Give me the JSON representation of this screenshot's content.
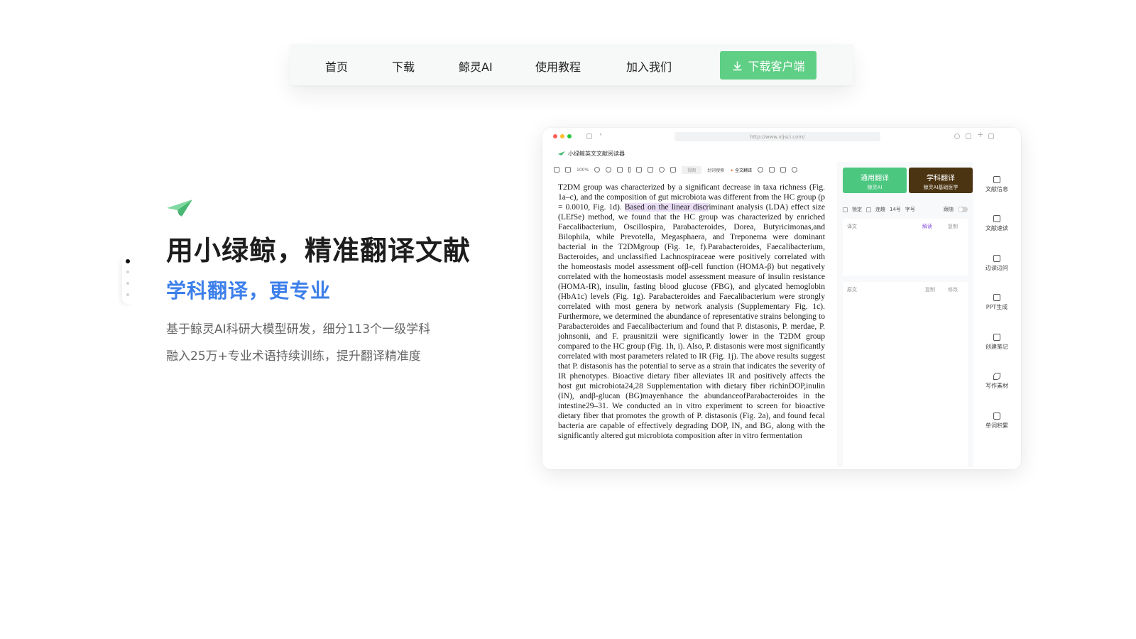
{
  "nav": {
    "items": [
      "首页",
      "下载",
      "鲸灵AI",
      "使用教程",
      "加入我们"
    ],
    "cta_label": "下载客户端",
    "cta_color": "#5fcf85"
  },
  "hero": {
    "title": "用小绿鲸，精准翻译文献",
    "subtitle": "学科翻译，更专业",
    "desc_line1": "基于鲸灵AI科研大模型研发，细分113个一级学科",
    "desc_line2": "融入25万+专业术语持续训练，提升翻译精准度",
    "accent_color": "#3c7fea"
  },
  "app": {
    "url": "http://www.xljsci.com/",
    "title": "小绿鲸英文文献阅读器",
    "toolbar": {
      "zoom": "100%",
      "view": "视图",
      "search": "划词搜索",
      "full_translate": "全文翻译"
    },
    "document_text": {
      "before_highlight": "T2DM group was characterized by a significant decrease in taxa richness (Fig. 1a–c), and the composition of gut microbiota was different from the HC group (p = 0.0010, Fig. 1d). ",
      "highlight": "Based on the linear discr",
      "after_highlight": "iminant analysis (LDA) effect size (LEfSe) method, we found that the HC group was characterized by enriched Faecalibacterium, Oscillospira, Parabacteroides, Dorea, Butyricimonas,and Bilophila, while Prevotella, Megasphaera, and Treponema were dominant bacterial in the T2DMgroup (Fig. 1e, f).Parabacteroides, Faecalibacterium, Bacteroides, and unclassified Lachnospiraceae were positively correlated with the homeostasis model assessment ofβ-cell function (HOMA-β) but negatively correlated with the homeostasis model assessment measure of insulin resistance (HOMA-IR), insulin, fasting blood glucose (FBG), and glycated hemoglobin (HbA1c) levels (Fig. 1g). Parabacteroides and Faecalibacterium were strongly correlated with most genera by network analysis (Supplementary Fig. 1c). Furthermore, we determined the abundance of representative strains belonging to Parabacteroides and Faecalibacterium and found that P. distasonis, P. merdae, P. johnsonii, and F. prausnitzii were significantly lower in the T2DM group compared to the HC group (Fig. 1h, i). Also, P. distasonis were most significantly correlated with most parameters related to IR (Fig. 1j). The above results suggest that P. distasonis has the potential to serve as a strain that indicates the severity of IR phenotypes. Bioactive dietary fiber alleviates IR and positively affects the host gut microbiota24,28 Supplementation with dietary fiber richinDOP,inulin (IN), andβ-glucan (BG)mayenhance the abundanceofParabacteroides in the intestine29–31. We conducted an in vitro experiment to screen for bioactive dietary fiber that promotes the growth of P. distasonis (Fig. 2a), and found fecal bacteria are capable of effectively degrading DOP, IN, and BG, along with the significantly altered gut microbiota composition after in vitro fermentation"
    },
    "translate_panel": {
      "general": {
        "label": "通用翻译",
        "sub": "鲸灵AI",
        "color": "#4cc780"
      },
      "subject": {
        "label": "学科翻译",
        "sub": "鲸灵AI基础医学",
        "color": "#4b3411"
      },
      "options": {
        "lock": "锁定",
        "continuous": "连趣",
        "size": "14号",
        "font": "字号",
        "follow": "跟随"
      },
      "translation_label": "译文",
      "translation_actions": [
        "解读",
        "复制"
      ],
      "original_label": "原文",
      "original_actions": [
        "复制",
        "修改"
      ]
    },
    "rail": [
      "文献信息",
      "文献速读",
      "边读边问",
      "PPT生成",
      "创建笔记",
      "写作素材",
      "单词积累"
    ]
  }
}
